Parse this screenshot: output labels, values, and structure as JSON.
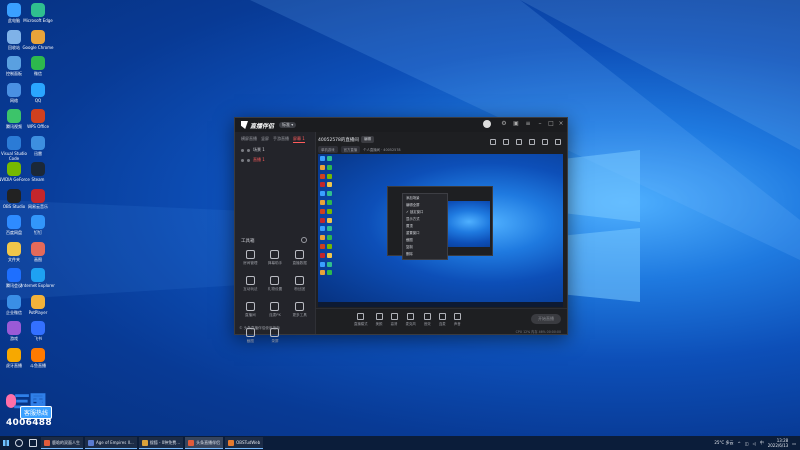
{
  "desktop": {
    "icons": [
      {
        "label": "此电脑",
        "color": "#3aa0ff"
      },
      {
        "label": "Microsoft Edge",
        "color": "#2fbf8f"
      },
      {
        "label": "回收站",
        "color": "#7fb2e8"
      },
      {
        "label": "Google Chrome",
        "color": "#e8a33a"
      },
      {
        "label": "控制面板",
        "color": "#5aa0e0"
      },
      {
        "label": "微信",
        "color": "#2db94d"
      },
      {
        "label": "网络",
        "color": "#4a90e2"
      },
      {
        "label": "QQ",
        "color": "#2aa6ff"
      },
      {
        "label": "腾讯视频",
        "color": "#3cc46a"
      },
      {
        "label": "WPS Office",
        "color": "#d0401f"
      },
      {
        "label": "Visual Studio Code",
        "color": "#2b7bd6"
      },
      {
        "label": "迅雷",
        "color": "#3d8fe0"
      },
      {
        "label": "NVIDIA GeForce",
        "color": "#76b900"
      },
      {
        "label": "Steam",
        "color": "#1b2838"
      },
      {
        "label": "OBS Studio",
        "color": "#222"
      },
      {
        "label": "网易云音乐",
        "color": "#c3262b"
      },
      {
        "label": "百度网盘",
        "color": "#2e8bff"
      },
      {
        "label": "钉钉",
        "color": "#3296fa"
      },
      {
        "label": "文件夹",
        "color": "#f0c64a"
      },
      {
        "label": "画图",
        "color": "#e46a5a"
      },
      {
        "label": "腾讯会议",
        "color": "#1e6fff"
      },
      {
        "label": "Internet Explorer",
        "color": "#1ea1f2"
      },
      {
        "label": "企业微信",
        "color": "#3a8ee6"
      },
      {
        "label": "PotPlayer",
        "color": "#f2b23a"
      },
      {
        "label": "游戏",
        "color": "#9a5ad6"
      },
      {
        "label": "飞书",
        "color": "#3370ff"
      },
      {
        "label": "虎牙直播",
        "color": "#f7a800"
      },
      {
        "label": "斗鱼直播",
        "color": "#ff7a00"
      }
    ]
  },
  "corner_logo": {
    "top": "三国",
    "mid": "客服热线",
    "number": "4006488"
  },
  "app": {
    "brand": "直播伴侣",
    "brand_badge": "标准 ▾",
    "tabs": [
      "横屏直播",
      "竖屏",
      "手游直播",
      "屏幕 1"
    ],
    "scenes": [
      "场景 1",
      "直播 1"
    ],
    "room_title": "40052578的直播间",
    "room_badge": "编辑",
    "room_sub_pills": [
      "单机游戏",
      "官方直播"
    ],
    "room_sub_text": "个人直播间 · 40052578",
    "toolbox_title": "工具箱",
    "tools": [
      "房间管理",
      "弹幕助手",
      "直播数据",
      "互动玩法",
      "礼物设置",
      "粉丝团",
      "直播间",
      "连麦PK",
      "更多工具",
      "截图",
      "录屏"
    ],
    "left_footer": "© 头条直播伴侣使用指南",
    "context_menu": [
      "添加场景",
      "编辑全屏",
      "锁定窗口",
      "显示方式",
      "置顶",
      "重置窗口",
      "截图",
      "复制",
      "删除"
    ],
    "bottom_tools": [
      "直播模式",
      "美颜",
      "高清",
      "麦克风",
      "音效",
      "连麦",
      "声音"
    ],
    "start_live": "开始直播",
    "status_text": "CPU 12%   内存 46%   00:00:00"
  },
  "taskbar": {
    "apps": [
      {
        "label": "鹿晗的双面人生",
        "color": "#e25b3a",
        "active": false
      },
      {
        "label": "Age of Empires II...",
        "color": "#5a7bd0",
        "active": false
      },
      {
        "label": "搜狐 - 0种免费...",
        "color": "#d9a13a",
        "active": false
      },
      {
        "label": "头条直播伴侣",
        "color": "#e15b3a",
        "active": true
      },
      {
        "label": "OBSTudWeb",
        "color": "#e67a2f",
        "active": false
      }
    ],
    "weather": "25°C 多云",
    "lang": "中",
    "time": "13:28",
    "date": "2022/6/13"
  }
}
